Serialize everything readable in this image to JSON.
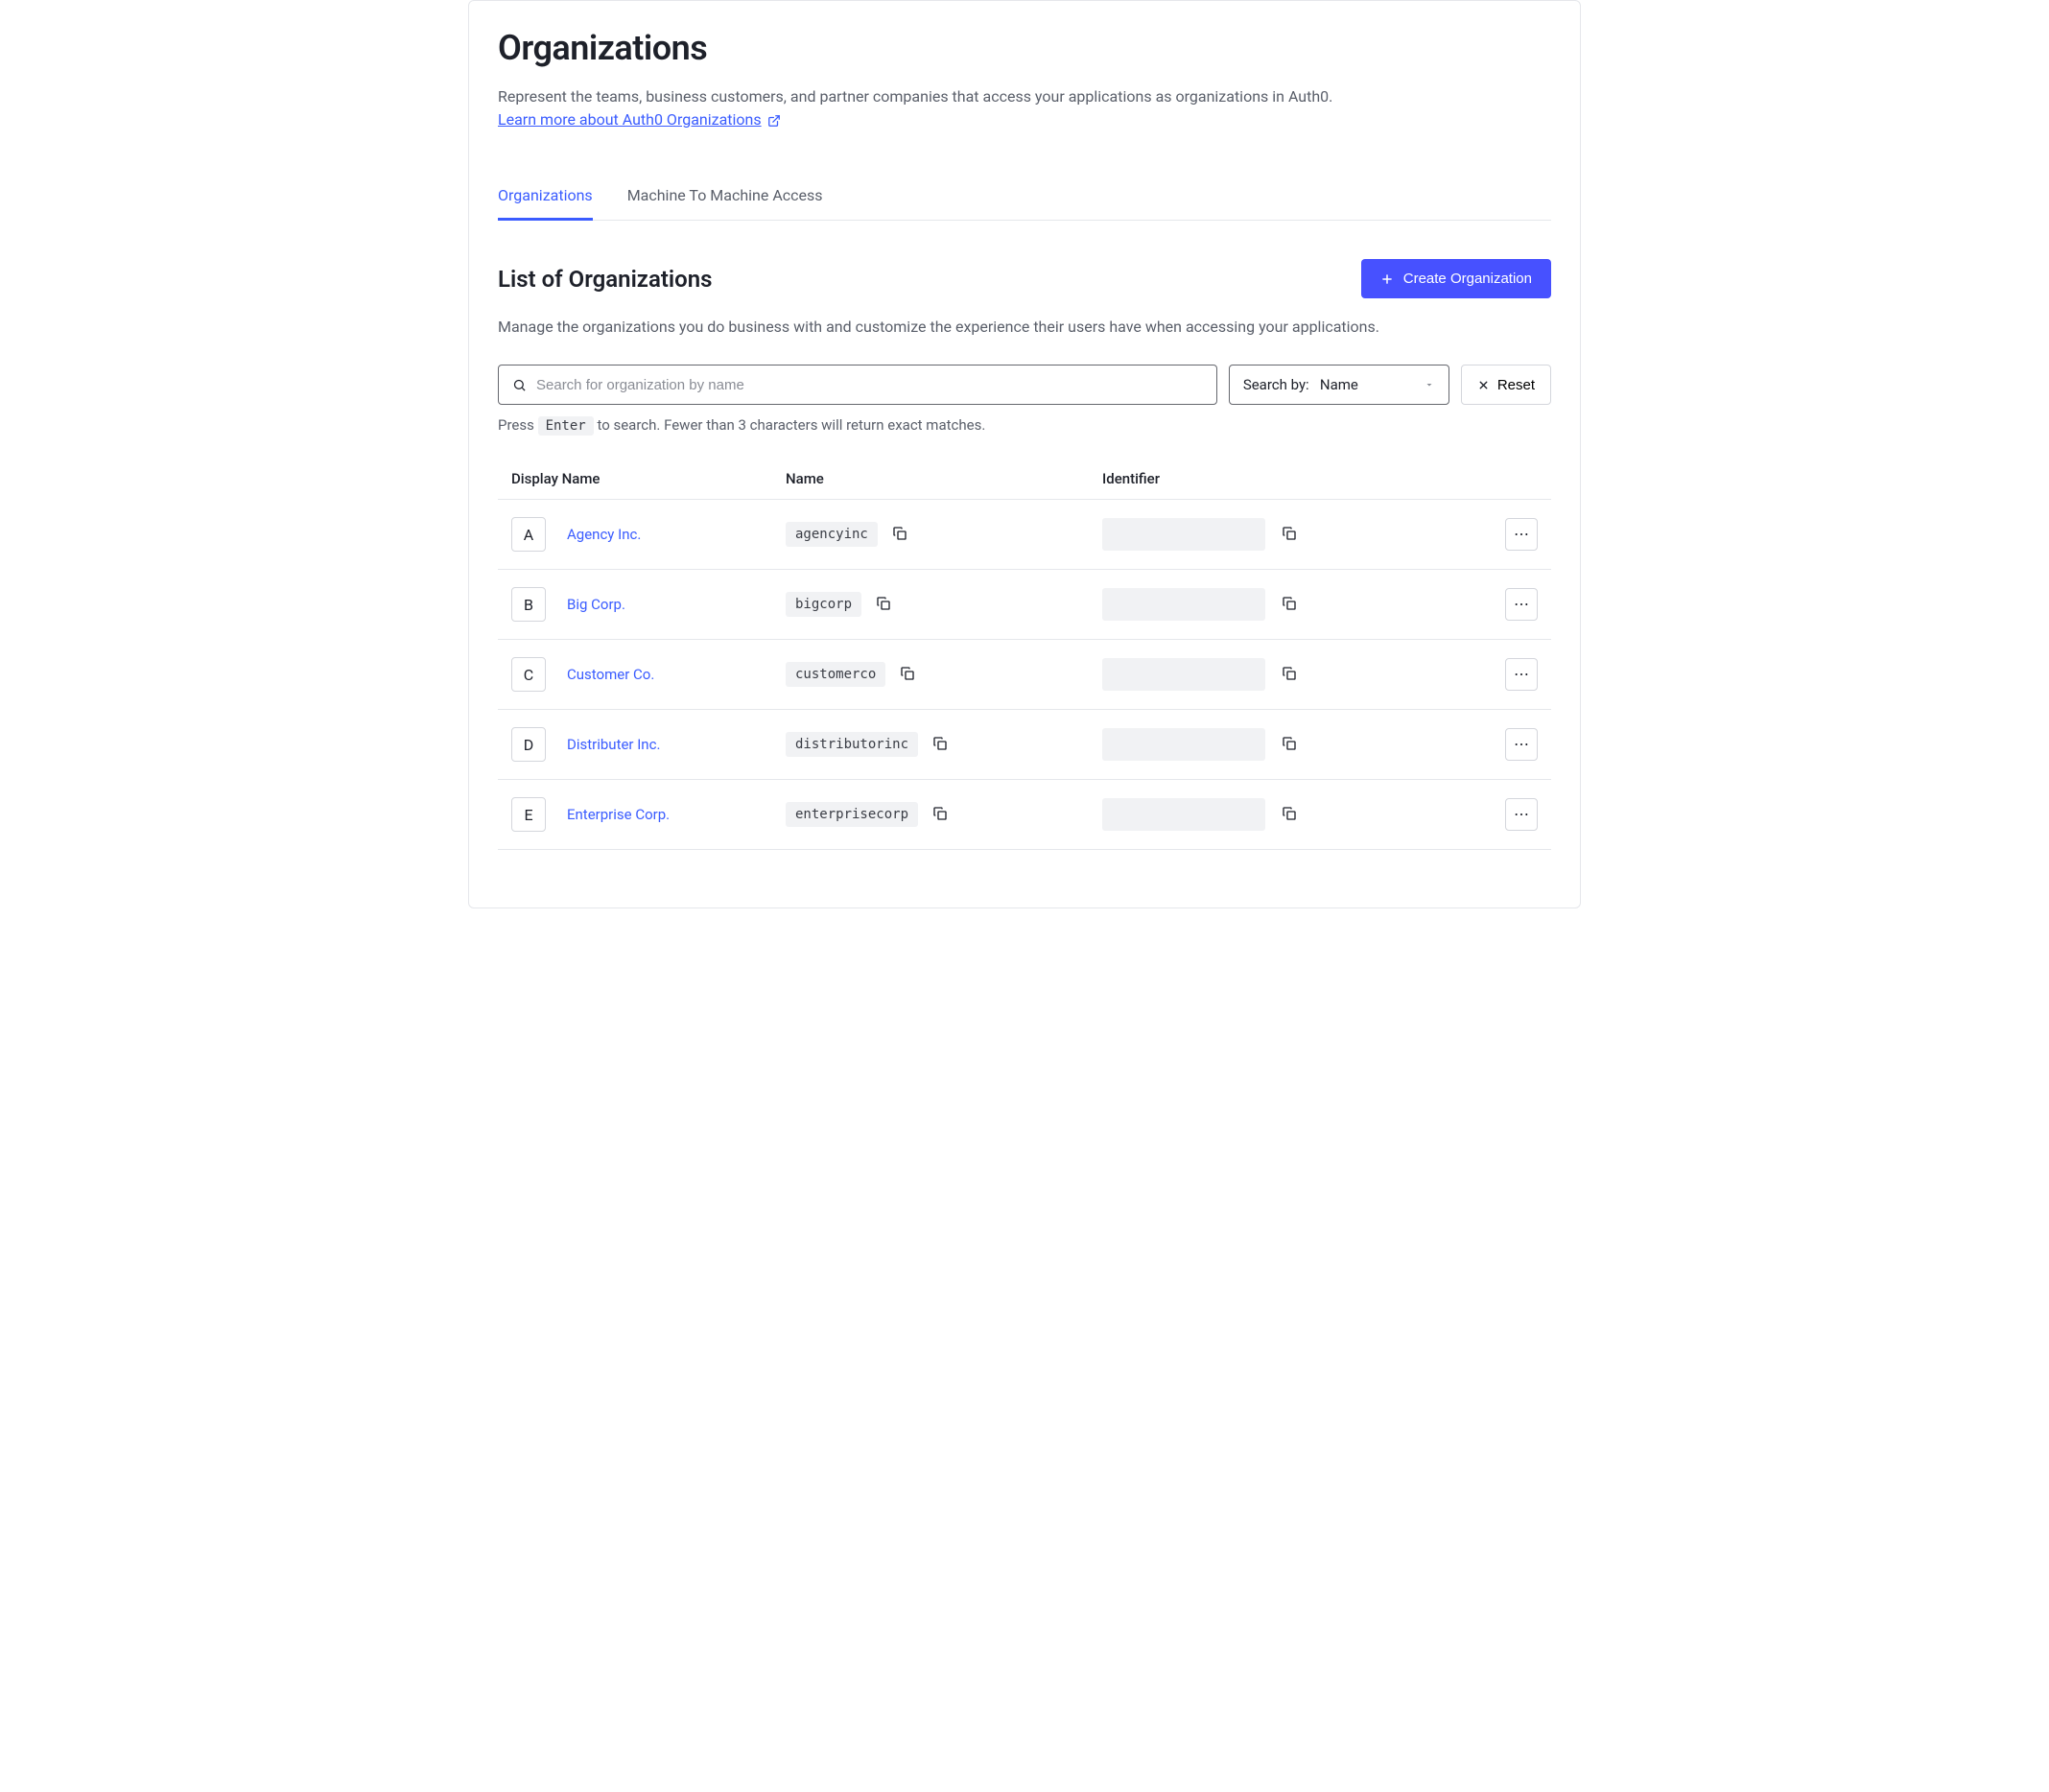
{
  "page": {
    "title": "Organizations",
    "description": "Represent the teams, business customers, and partner companies that access your applications as organizations in Auth0.",
    "learn_more": "Learn more about Auth0 Organizations"
  },
  "tabs": [
    {
      "label": "Organizations",
      "active": true
    },
    {
      "label": "Machine To Machine Access",
      "active": false
    }
  ],
  "section": {
    "title": "List of Organizations",
    "create_label": "Create Organization",
    "description": "Manage the organizations you do business with and customize the experience their users have when accessing your applications."
  },
  "search": {
    "placeholder": "Search for organization by name",
    "dropdown_label": "Search by:",
    "dropdown_value": "Name",
    "reset_label": "Reset",
    "hint_pre": "Press ",
    "hint_key": "Enter",
    "hint_post": " to search. Fewer than 3 characters will return exact matches."
  },
  "table": {
    "headers": {
      "display": "Display Name",
      "name": "Name",
      "identifier": "Identifier"
    },
    "rows": [
      {
        "letter": "A",
        "display": "Agency Inc.",
        "name": "agencyinc"
      },
      {
        "letter": "B",
        "display": "Big Corp.",
        "name": "bigcorp"
      },
      {
        "letter": "C",
        "display": "Customer Co.",
        "name": "customerco"
      },
      {
        "letter": "D",
        "display": "Distributer Inc.",
        "name": "distributorinc"
      },
      {
        "letter": "E",
        "display": "Enterprise Corp.",
        "name": "enterprisecorp"
      }
    ]
  }
}
